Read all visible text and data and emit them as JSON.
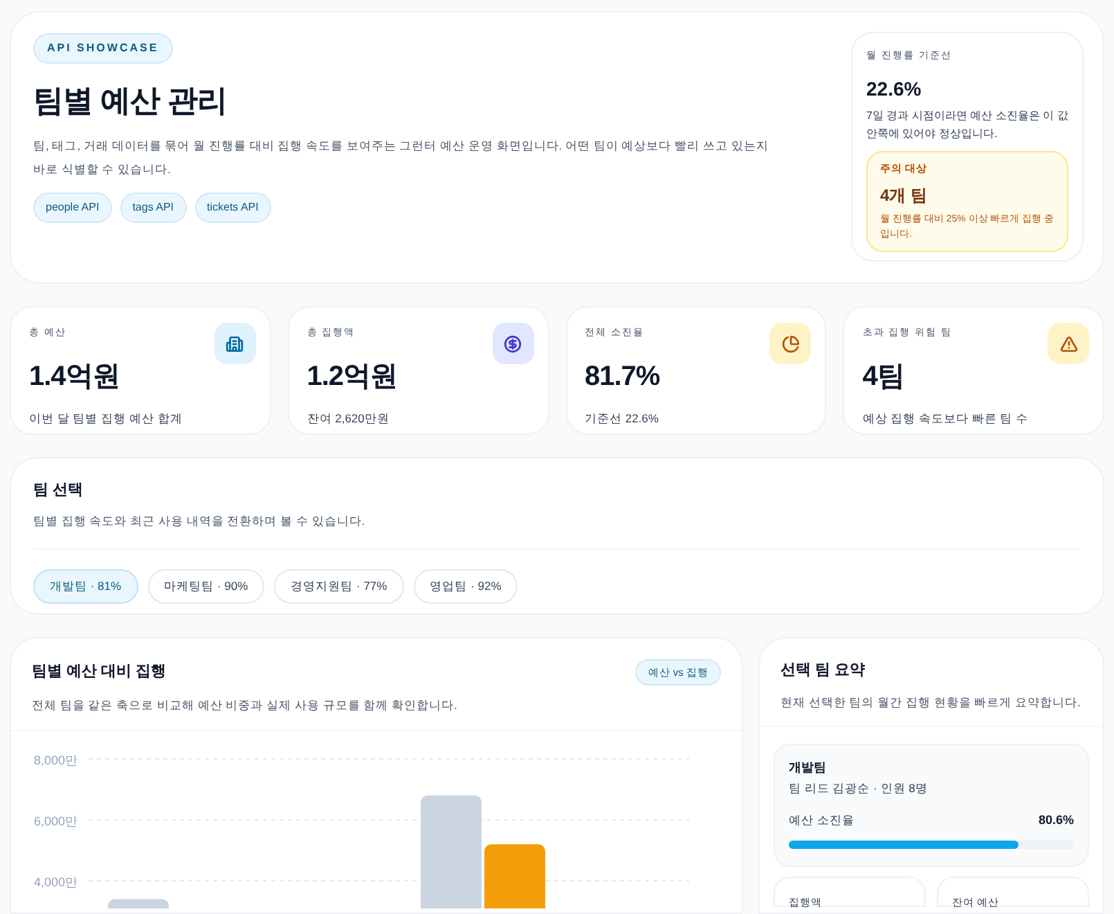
{
  "header": {
    "badge": "API SHOWCASE",
    "title": "팀별 예산 관리",
    "description": "팀, 태그, 거래 데이터를 묶어 월 진행률 대비 집행 속도를 보여주는 그런터 예산 운영 화면입니다. 어떤 팀이 예상보다 빨리 쓰고 있는지 바로 식별할 수 있습니다.",
    "sources": [
      "people API",
      "tags API",
      "tickets API"
    ],
    "baseline": {
      "label": "월 진행률 기준선",
      "value": "22.6%",
      "note": "7일 경과 시점이라면 예산 소진율은 이 값 안쪽에 있어야 정상입니다.",
      "alert": {
        "label": "주의 대상",
        "value": "4개 팀",
        "note": "월 진행률 대비 25% 이상 빠르게 집행 중입니다."
      }
    }
  },
  "stats": [
    {
      "kind": "budget",
      "label": "총 예산",
      "value": "1.4억원",
      "note": "이번 달 팀별 집행 예산 합계"
    },
    {
      "kind": "spent",
      "label": "총 집행액",
      "value": "1.2억원",
      "note": "잔여 2,620만원"
    },
    {
      "kind": "rate",
      "label": "전체 소진율",
      "value": "81.7%",
      "note": "기준선 22.6%"
    },
    {
      "kind": "risk",
      "label": "초과 집행 위험 팀",
      "value": "4팀",
      "note": "예상 집행 속도보다 빠른 팀 수"
    }
  ],
  "team_select": {
    "title": "팀 선택",
    "description": "팀별 집행 속도와 최근 사용 내역을 전환하며 볼 수 있습니다.",
    "teams": [
      {
        "label": "개발팀 · 81%",
        "selected": true
      },
      {
        "label": "마케팅팀 · 90%",
        "selected": false
      },
      {
        "label": "경영지원팀 · 77%",
        "selected": false
      },
      {
        "label": "영업팀 · 92%",
        "selected": false
      }
    ]
  },
  "budget_chart": {
    "title": "팀별 예산 대비 집행",
    "badge": "예산 vs 집행",
    "description": "전체 팀을 같은 축으로 비교해 예산 비중과 실제 사용 규모를 함께 확인합니다.",
    "chart_data": {
      "type": "bar",
      "ylim": [
        0,
        8000
      ],
      "yticks": [
        {
          "value": 4000,
          "label": "4,000만"
        },
        {
          "value": 6000,
          "label": "6,000만"
        },
        {
          "value": 8000,
          "label": "8,000만"
        }
      ],
      "series": [
        {
          "color": "#cbd5e1",
          "values": [
            3400,
            null,
            6800,
            null
          ]
        },
        {
          "color": "#f59e0b",
          "values": [
            null,
            null,
            5200,
            null
          ]
        }
      ]
    }
  },
  "summary": {
    "title": "선택 팀 요약",
    "description": "현재 선택한 팀의 월간 집행 현황을 빠르게 요약합니다.",
    "team": "개발팀",
    "lead": "팀 리드 김광순 · 인원 8명",
    "rate_label": "예산 소진율",
    "rate_value": "80.6%",
    "level": 0.806,
    "tiles": [
      "집행액",
      "잔여 예산"
    ]
  }
}
